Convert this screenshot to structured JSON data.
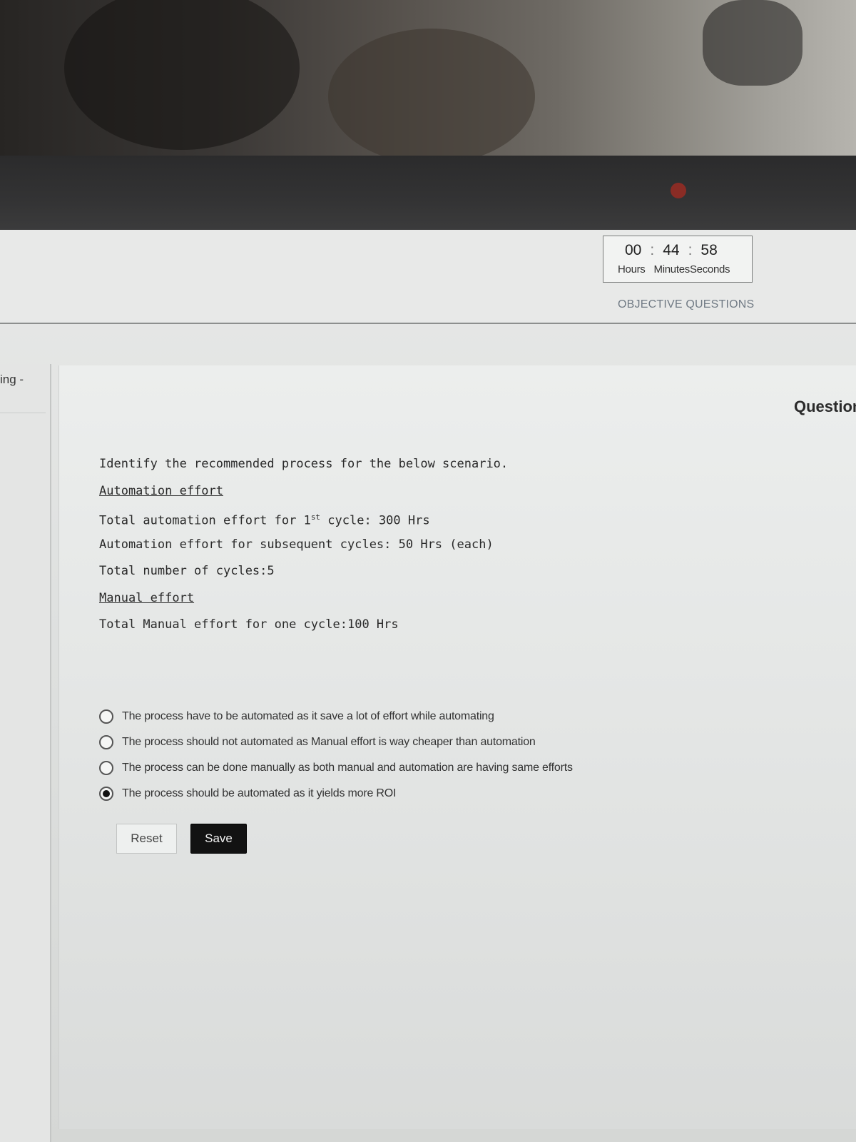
{
  "timer": {
    "hours": "00",
    "minutes": "44",
    "seconds": "58",
    "separator": ":",
    "labels": {
      "hours": "Hours",
      "minutes": "Minutes",
      "seconds": "Seconds"
    }
  },
  "section_label": "OBJECTIVE QUESTIONS",
  "left_panel": {
    "truncated_text": "ing -"
  },
  "right_heading": "Question",
  "question": {
    "prompt": "Identify the recommended process for the below scenario.",
    "automation_heading": "Automation effort",
    "line1_prefix": "Total automation effort for 1",
    "line1_sup": "st",
    "line1_suffix": " cycle: 300 Hrs",
    "line2": "Automation effort for subsequent cycles: 50 Hrs (each)",
    "line3": "Total number of cycles:5",
    "manual_heading": "Manual effort",
    "line4": "Total Manual effort for one cycle:100 Hrs"
  },
  "options": [
    {
      "label": "The process have to be automated as it save a lot of effort while automating",
      "selected": false
    },
    {
      "label": "The process should not automated as Manual effort is way cheaper than automation",
      "selected": false
    },
    {
      "label": "The process can be done manually as both manual and automation are having same efforts",
      "selected": false
    },
    {
      "label": "The process should be automated as it yields more ROI",
      "selected": true
    }
  ],
  "buttons": {
    "reset": "Reset",
    "save": "Save"
  }
}
